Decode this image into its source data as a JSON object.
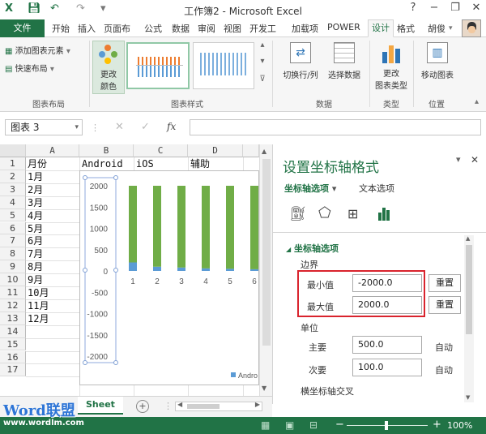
{
  "window": {
    "title": "工作簿2 - Microsoft Excel",
    "help": "?",
    "minimize": "−",
    "restore": "❐",
    "close": "✕"
  },
  "tabs": {
    "file": "文件",
    "items": [
      "开始",
      "插入",
      "页面布",
      "公式",
      "数据",
      "审阅",
      "视图",
      "开发工",
      "加载项",
      "POWER",
      "设计",
      "格式"
    ],
    "user": "胡俊"
  },
  "ribbon": {
    "add_element": "添加图表元素",
    "quick_layout": "快速布局",
    "change_colors": [
      "更改",
      "颜色"
    ],
    "switch_row_col": "切换行/列",
    "select_data": "选择数据",
    "change_type": [
      "更改",
      "图表类型"
    ],
    "move_chart": "移动图表",
    "groups": [
      "图表布局",
      "图表样式",
      "数据",
      "类型",
      "位置"
    ]
  },
  "formula_bar": {
    "name_box": "图表 3",
    "cancel": "✕",
    "enter": "✓",
    "fx": "fx",
    "value": ""
  },
  "sheet": {
    "columns": [
      "A",
      "B",
      "C",
      "D"
    ],
    "rows": [
      "1",
      "2",
      "3",
      "4",
      "5",
      "6",
      "7",
      "8",
      "9",
      "10",
      "11",
      "12",
      "13",
      "14",
      "15",
      "16",
      "17"
    ],
    "header_row": [
      "月份",
      "Android",
      "iOS",
      "辅助"
    ],
    "months": [
      "1月",
      "2月",
      "3月",
      "4月",
      "5月",
      "6月",
      "7月",
      "8月",
      "9月",
      "10月",
      "11月",
      "12月"
    ],
    "tab_name": "Sheet",
    "add_sheet": "+"
  },
  "chart_data": {
    "type": "bar",
    "categories": [
      "1",
      "2",
      "3",
      "4",
      "5",
      "6"
    ],
    "series": [
      {
        "name": "Android",
        "values": [
          200,
          100,
          80,
          60,
          50,
          40
        ],
        "color": "#5b9bd5"
      },
      {
        "name": "",
        "values": [
          1800,
          1900,
          1920,
          1940,
          1950,
          1960
        ],
        "color": "#70ad47"
      }
    ],
    "ylim": [
      -2000,
      2000
    ],
    "yticks": [
      "2000",
      "1500",
      "1000",
      "500",
      "0",
      "-500",
      "-1000",
      "-1500",
      "-2000"
    ],
    "legend": "Andro"
  },
  "pane": {
    "title": "设置坐标轴格式",
    "tab_axis": "坐标轴选项",
    "tab_text": "文本选项",
    "section": "坐标轴选项",
    "bounds": "边界",
    "min_label": "最小值",
    "min_value": "-2000.0",
    "max_label": "最大值",
    "max_value": "2000.0",
    "reset": "重置",
    "units": "单位",
    "major_label": "主要",
    "major_value": "500.0",
    "minor_label": "次要",
    "minor_value": "100.0",
    "auto": "自动",
    "cross": "横坐标轴交叉",
    "highlight_color": "#d9232d"
  },
  "status": {
    "zoom": "100%"
  },
  "watermark": {
    "brand": "Word联盟",
    "url": "www.wordlm.com"
  },
  "colors": {
    "accent": "#217346",
    "bar_blue": "#5b9bd5",
    "bar_green": "#70ad47"
  }
}
